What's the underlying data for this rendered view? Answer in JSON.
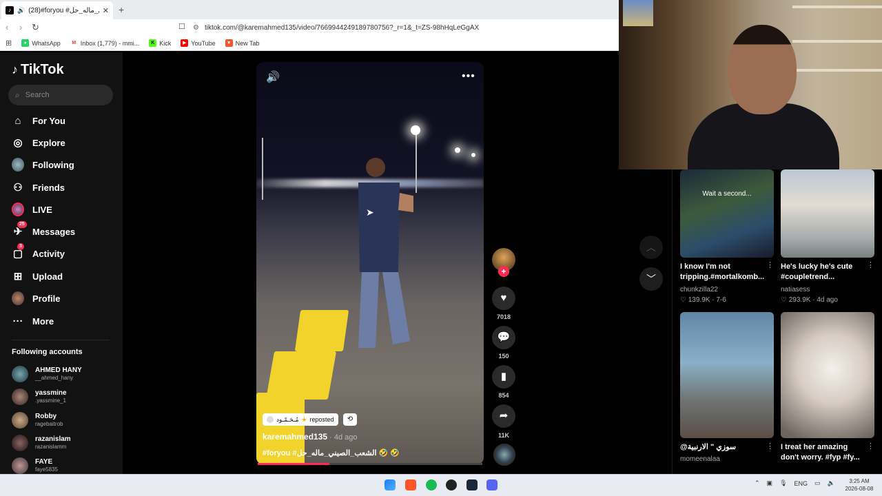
{
  "browser": {
    "tab_title": "(28)#foryou #الشعب_الصيني_ماله_حل",
    "url": "tiktok.com/@karemahmed135/video/7669944249189780756?_r=1&_t=ZS-98hHqLeGgAX",
    "bookmarks": [
      {
        "label": "WhatsApp",
        "color": "#25d366"
      },
      {
        "label": "Inbox (1,779) - mmi...",
        "color": "#ea4335"
      },
      {
        "label": "Kick",
        "color": "#53fc18"
      },
      {
        "label": "YouTube",
        "color": "#ff0000"
      },
      {
        "label": "New Tab",
        "color": "#fb542b"
      }
    ]
  },
  "sidebar": {
    "logo": "TikTok",
    "search_placeholder": "Search",
    "nav": [
      {
        "label": "For You",
        "icon": "home-icon"
      },
      {
        "label": "Explore",
        "icon": "compass-icon"
      },
      {
        "label": "Following",
        "icon": "avatar"
      },
      {
        "label": "Friends",
        "icon": "friends-icon"
      },
      {
        "label": "LIVE",
        "icon": "live-avatar"
      },
      {
        "label": "Messages",
        "icon": "messages-icon",
        "badge": "25"
      },
      {
        "label": "Activity",
        "icon": "activity-icon",
        "badge": "3"
      },
      {
        "label": "Upload",
        "icon": "upload-icon"
      },
      {
        "label": "Profile",
        "icon": "avatar"
      },
      {
        "label": "More",
        "icon": "more-icon"
      }
    ],
    "following_title": "Following accounts",
    "accounts": [
      {
        "name": "AHMED HANY",
        "handle": "__ahmed_hany",
        "color": "#7aa"
      },
      {
        "name": "yassmine",
        "handle": ".yassmine_1",
        "color": "#a87"
      },
      {
        "name": "Robby",
        "handle": "ragebaitrob",
        "color": "#ca8"
      },
      {
        "name": "razanislam",
        "handle": "razanislamm",
        "color": "#866"
      },
      {
        "name": "FAYE",
        "handle": "faye5835",
        "color": "#b99"
      }
    ]
  },
  "video": {
    "repost_name": "مُـحَـمّـود",
    "repost_label": "reposted",
    "author": "karemahmed135",
    "time": " · 4d ago",
    "caption": "#foryou #الشعب_الصيني_ماله_حل 🤣 🤣",
    "progress": 0.32,
    "likes": "7018",
    "comments": "150",
    "saves": "854",
    "shares": "11K"
  },
  "right_feed": [
    {
      "overlay": "Wait a second...",
      "title": "I know I'm not tripping.#mortalkomb...",
      "user": "chunkzilla22",
      "stats": "♡ 139.9K · 7-6",
      "bg": "linear-gradient(160deg,#1b2a3a,#3d5a3c 40%,#2b4d6a 70%,#1a1a2a)"
    },
    {
      "overlay": "",
      "title": "He's lucky he's cute #coupletrend...",
      "user": "natiasess",
      "stats": "♡ 293.9K · 4d ago",
      "bg": "linear-gradient(180deg,#bcc8d2,#e2dcd2 40%,#a3a8aa 80%,#7a7f80)"
    },
    {
      "overlay": "",
      "title": "@سوزي \" الارنبية",
      "user": "momeenalaa",
      "stats": "",
      "bg": "linear-gradient(180deg,#5f86a6,#8ab0c8 40%,#6f7472 70%,#5a4e46)"
    },
    {
      "overlay": "",
      "title": "I treat her amazing don't worry. #fyp #fy...",
      "user": "",
      "stats": "",
      "bg": "radial-gradient(circle at 55% 45%,#f4f0ec,#d6ccc2 40%,#6d6660 90%)"
    }
  ],
  "taskbar": {
    "lang": "ENG",
    "time": "3:25 AM",
    "date": "2026-08-08"
  }
}
